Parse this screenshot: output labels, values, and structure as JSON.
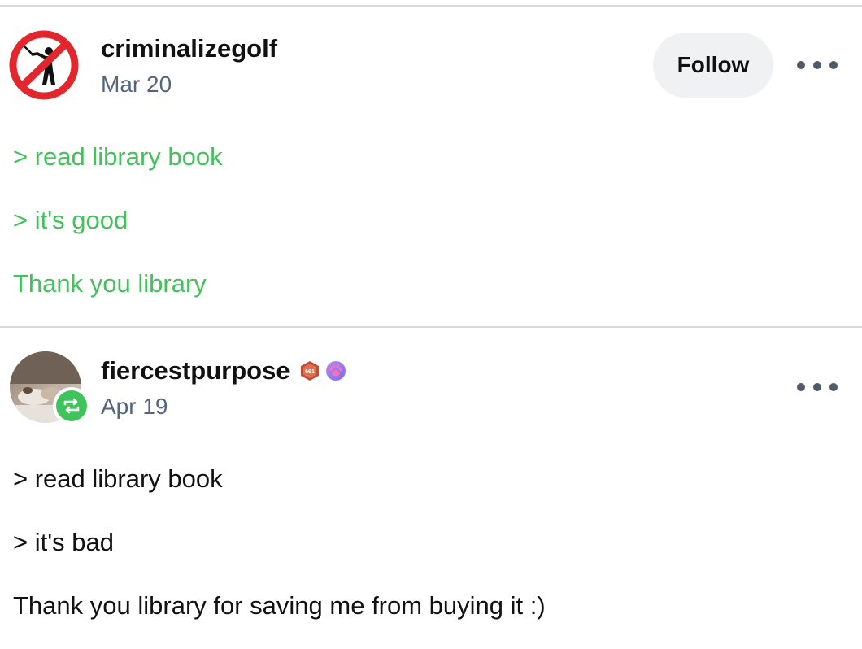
{
  "posts": [
    {
      "username": "criminalizegolf",
      "date": "Mar 20",
      "avatar_icon": "no-golf-icon",
      "follow_label": "Follow",
      "text_color": "#43c15a",
      "lines": [
        "> read library book",
        "> it's good",
        "Thank you library"
      ]
    },
    {
      "username": "fiercestpurpose",
      "date": "Apr 19",
      "avatar_icon": "photo-avatar",
      "badges": [
        "hexagon-badge-icon",
        "paw-badge-icon"
      ],
      "badge_hex_text": "661",
      "reblog_icon": "reblog-icon",
      "text_color": "#111111",
      "lines": [
        "> read library book",
        "> it's bad",
        "Thank you library for saving me from buying it :)"
      ]
    }
  ],
  "colors": {
    "accent_green": "#43c15a",
    "date_gray": "#55667a",
    "button_bg": "#f0f1f3"
  }
}
